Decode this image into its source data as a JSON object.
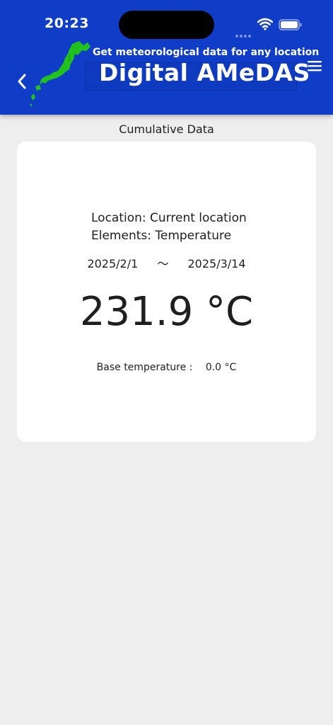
{
  "status_bar": {
    "time": "20:23"
  },
  "header": {
    "subtitle": "Get meteorological data for any location",
    "title": "Digital AMeDAS",
    "logo_icon": "japan-map-icon",
    "back_icon": "chevron-left-icon",
    "menu_icon": "hamburger-menu-icon",
    "background_color": "#0f3dc7",
    "logo_color": "#22c21e"
  },
  "page": {
    "section_title": "Cumulative Data"
  },
  "card": {
    "location": "Location: Current location",
    "elements": "Elements: Temperature",
    "start_date": "2025/2/1",
    "range_separator": "〜",
    "end_date": "2025/3/14",
    "value": "231.9 °C",
    "base_label": "Base temperature :",
    "base_value": "0.0 °C"
  }
}
